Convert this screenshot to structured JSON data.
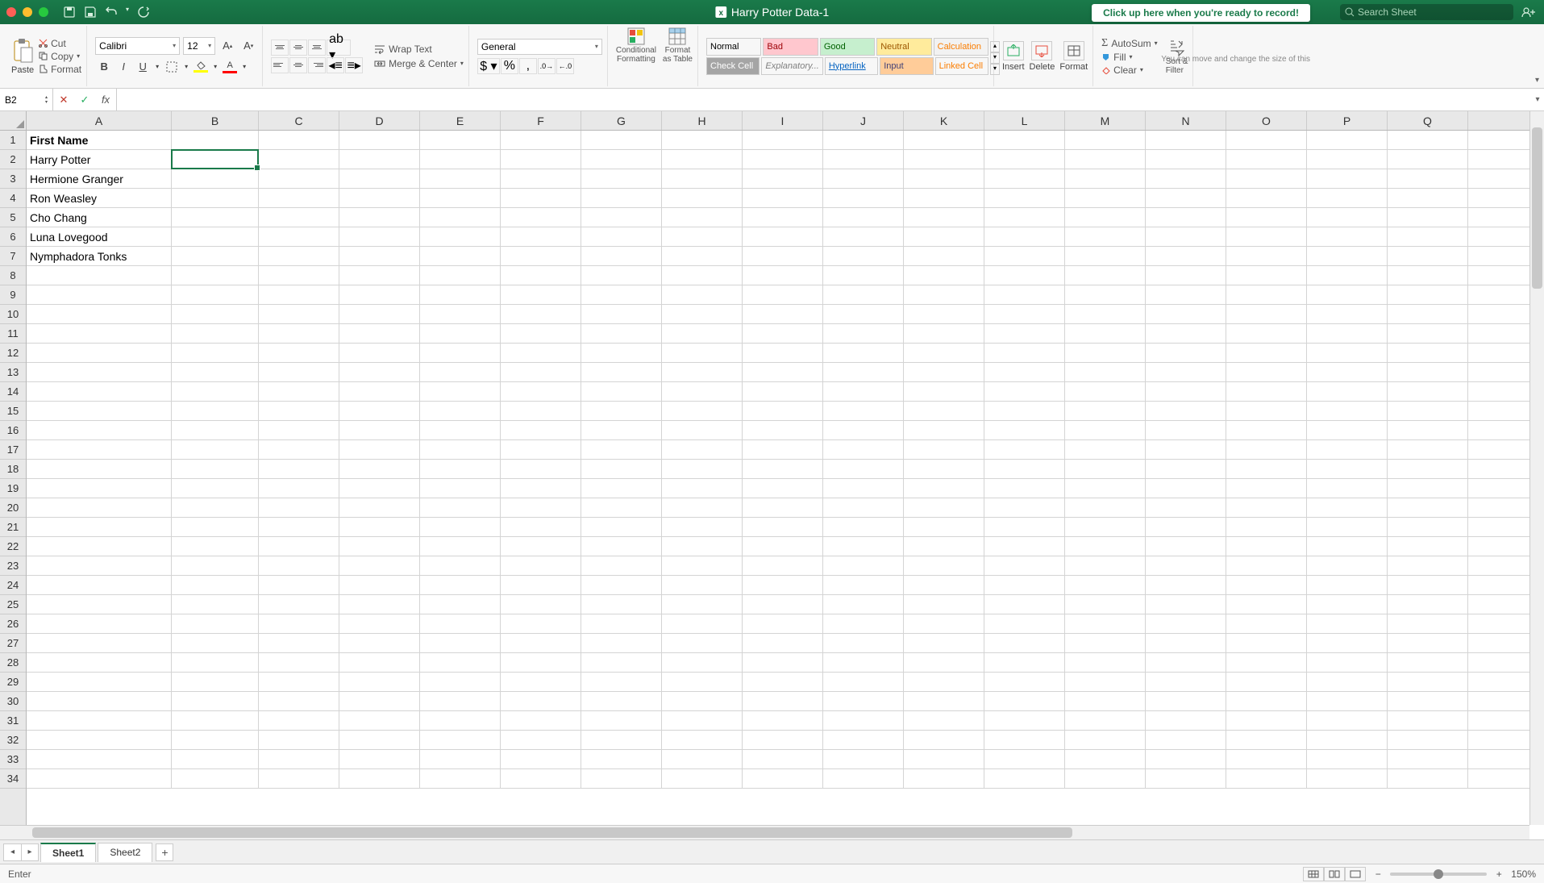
{
  "titlebar": {
    "doc_name": "Harry Potter Data-1",
    "search_placeholder": "Search Sheet"
  },
  "hint": {
    "main": "Click up here when you're ready to record!",
    "sub": "You can move and change the size of this"
  },
  "ribbon": {
    "paste": "Paste",
    "cut": "Cut",
    "copy": "Copy",
    "format_painter": "Format",
    "font_name": "Calibri",
    "font_size": "12",
    "wrap_text": "Wrap Text",
    "merge_center": "Merge & Center",
    "number_format": "General",
    "cond_fmt": "Conditional\nFormatting",
    "fmt_table": "Format\nas Table",
    "styles": {
      "normal": "Normal",
      "bad": "Bad",
      "good": "Good",
      "neutral": "Neutral",
      "calculation": "Calculation",
      "check_cell": "Check Cell",
      "explanatory": "Explanatory...",
      "hyperlink": "Hyperlink",
      "input": "Input",
      "linked_cell": "Linked Cell"
    },
    "insert": "Insert",
    "delete": "Delete",
    "format": "Format",
    "autosum": "AutoSum",
    "fill": "Fill",
    "clear": "Clear",
    "sort_filter": "Sort &\nFilter"
  },
  "namebox": "B2",
  "columns": [
    "A",
    "B",
    "C",
    "D",
    "E",
    "F",
    "G",
    "H",
    "I",
    "J",
    "K",
    "L",
    "M",
    "N",
    "O",
    "P",
    "Q"
  ],
  "row_count": 34,
  "data": {
    "A1": "First Name",
    "A2": "Harry Potter",
    "A3": "Hermione Granger",
    "A4": "Ron Weasley",
    "A5": "Cho Chang",
    "A6": "Luna Lovegood",
    "A7": "Nymphadora Tonks"
  },
  "active": {
    "col": "B",
    "row": 2
  },
  "tabs": {
    "sheet1": "Sheet1",
    "sheet2": "Sheet2"
  },
  "status": {
    "mode": "Enter",
    "zoom": "150%"
  }
}
